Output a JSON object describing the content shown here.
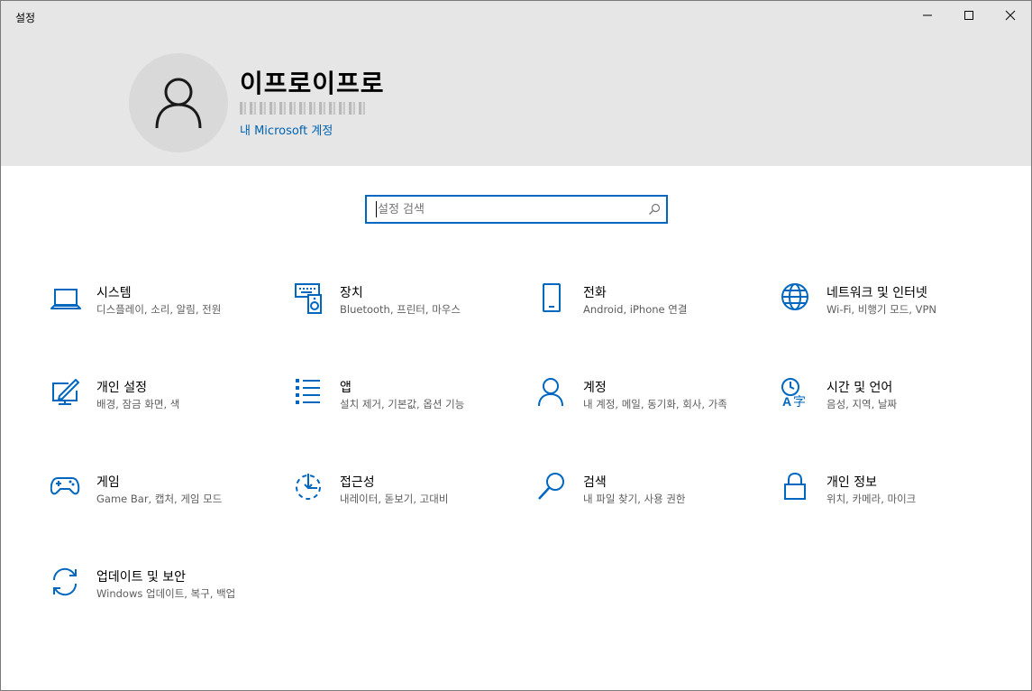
{
  "window": {
    "title": "설정",
    "controls": [
      "minimize-icon",
      "maximize-icon",
      "close-icon"
    ]
  },
  "profile": {
    "name": "이프로이프로",
    "email_redacted": true,
    "account_link": "내 Microsoft 계정"
  },
  "search": {
    "placeholder": "설정 검색",
    "value": ""
  },
  "accent_color": "#0067c0",
  "categories": [
    {
      "title": "시스템",
      "subtitle": "디스플레이, 소리, 알림, 전원",
      "icon": "laptop-icon"
    },
    {
      "title": "장치",
      "subtitle": "Bluetooth, 프린터, 마우스",
      "icon": "keyboard-speaker-icon"
    },
    {
      "title": "전화",
      "subtitle": "Android, iPhone 연결",
      "icon": "phone-icon"
    },
    {
      "title": "네트워크 및 인터넷",
      "subtitle": "Wi-Fi, 비행기 모드, VPN",
      "icon": "globe-icon"
    },
    {
      "title": "개인 설정",
      "subtitle": "배경, 잠금 화면, 색",
      "icon": "pen-tablet-icon"
    },
    {
      "title": "앱",
      "subtitle": "설치 제거, 기본값, 옵션 기능",
      "icon": "apps-list-icon"
    },
    {
      "title": "계정",
      "subtitle": "내 계정, 메일, 동기화, 회사, 가족",
      "icon": "person-icon"
    },
    {
      "title": "시간 및 언어",
      "subtitle": "음성, 지역, 날짜",
      "icon": "time-language-icon"
    },
    {
      "title": "게임",
      "subtitle": "Game Bar, 캡처, 게임 모드",
      "icon": "gamepad-icon"
    },
    {
      "title": "접근성",
      "subtitle": "내레이터, 돋보기, 고대비",
      "icon": "ease-of-access-icon"
    },
    {
      "title": "검색",
      "subtitle": "내 파일 찾기, 사용 권한",
      "icon": "search-icon"
    },
    {
      "title": "개인 정보",
      "subtitle": "위치, 카메라, 마이크",
      "icon": "lock-icon"
    },
    {
      "title": "업데이트 및 보안",
      "subtitle": "Windows 업데이트, 복구, 백업",
      "icon": "sync-icon"
    }
  ]
}
